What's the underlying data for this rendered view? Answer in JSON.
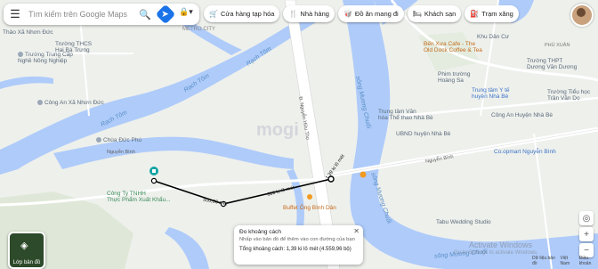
{
  "search": {
    "placeholder": "Tìm kiếm trên Google Maps"
  },
  "chips": [
    {
      "icon": "cart-icon",
      "label": "Cửa hàng tạp hóa"
    },
    {
      "icon": "fork-knife-icon",
      "label": "Nhà hàng"
    },
    {
      "icon": "takeout-icon",
      "label": "Đồ ăn mang đi"
    },
    {
      "icon": "bed-icon",
      "label": "Khách sạn"
    },
    {
      "icon": "gas-pump-icon",
      "label": "Trạm xăng"
    }
  ],
  "places": {
    "metro_city": "METRO CITY",
    "thao_xa": "Thảo Xã Nhơn Đức",
    "truong_thcs": "Trường THCS\nHai Bà Trưng",
    "truong_tc": "Trường Trung Cấp\nNghề Nông Nghiệp",
    "rach_tom1": "Rạch Tôm",
    "rach_tom2": "Rạch Tôm",
    "rach_tom3": "Rạch Tôm",
    "cong_an_xa": "Công An Xã Nhơn Đức",
    "chua_duc_phu": "Chùa Đức Phú",
    "nguyen_binh_left": "Nguyễn Bình",
    "cong_ty": "Công Ty TNHH\nThực Phẩm Xuất Khẩu...",
    "song_muong_chuoi1": "sông Mương Chuối",
    "song_muong_chuoi2": "sông Mương Chuối",
    "song_muong_chuoi3": "sông Mương Chuối",
    "ben_xua": "Bến Xưa Cafe - The\nOld Dock Coffee & Tea",
    "truong_thpt": "Trường THPT\nDương Văn Dương",
    "phu_xuan": "PHÚ XUÂN",
    "khu_dan_cu": "Khu Dân Cư",
    "phim_truong": "Phim trường\nHoàng Sa",
    "trung_tam_yte": "Trung tâm Y tế\nhuyện Nhà Bè",
    "truong_tieu_hoc": "Trường Tiểu học\nTrần Văn Do",
    "cong_an_huyen": "Công An Huyện Nhà Bè",
    "trung_tam_van": "Trung tâm Văn\nhóa Thể thao Nhà Bè",
    "ubnd": "UBND huyện Nhà Bè",
    "nguyen_binh_right": "Nguyễn Bình",
    "coopmart": "Co.opmart Nguyễn Bình",
    "buffet": "Buffet Ông Bình Dân",
    "tabu": "Tabu Wedding Studio",
    "duong_huynh_tan_phat": "Đ. Nguyễn Hữu Thọ",
    "seg1": "500,00 mét",
    "seg2": "600 ki lô mét",
    "seg3": "~1,39 ki lô mét"
  },
  "layers": {
    "label": "Lớp bản đồ"
  },
  "measure": {
    "title": "Đo khoảng cách",
    "hint": "Nhấp vào bản đồ để thêm vào con đường của bạn",
    "total": "Tổng khoảng cách: 1,39 ki lô mét (4.559,96 bộ)"
  },
  "watermark": {
    "line1": "Activate Windows",
    "line2": "Go to Settings to activate Windows."
  },
  "brand": "mogi",
  "footer": [
    "Dữ liệu bản đồ",
    "Việt Nam",
    "Điều khoản"
  ],
  "colors": {
    "water": "#aecbfa",
    "land": "#eef0ec",
    "road": "#ffffff",
    "accent": "#1a73e8",
    "park": "#c8e6c9"
  }
}
